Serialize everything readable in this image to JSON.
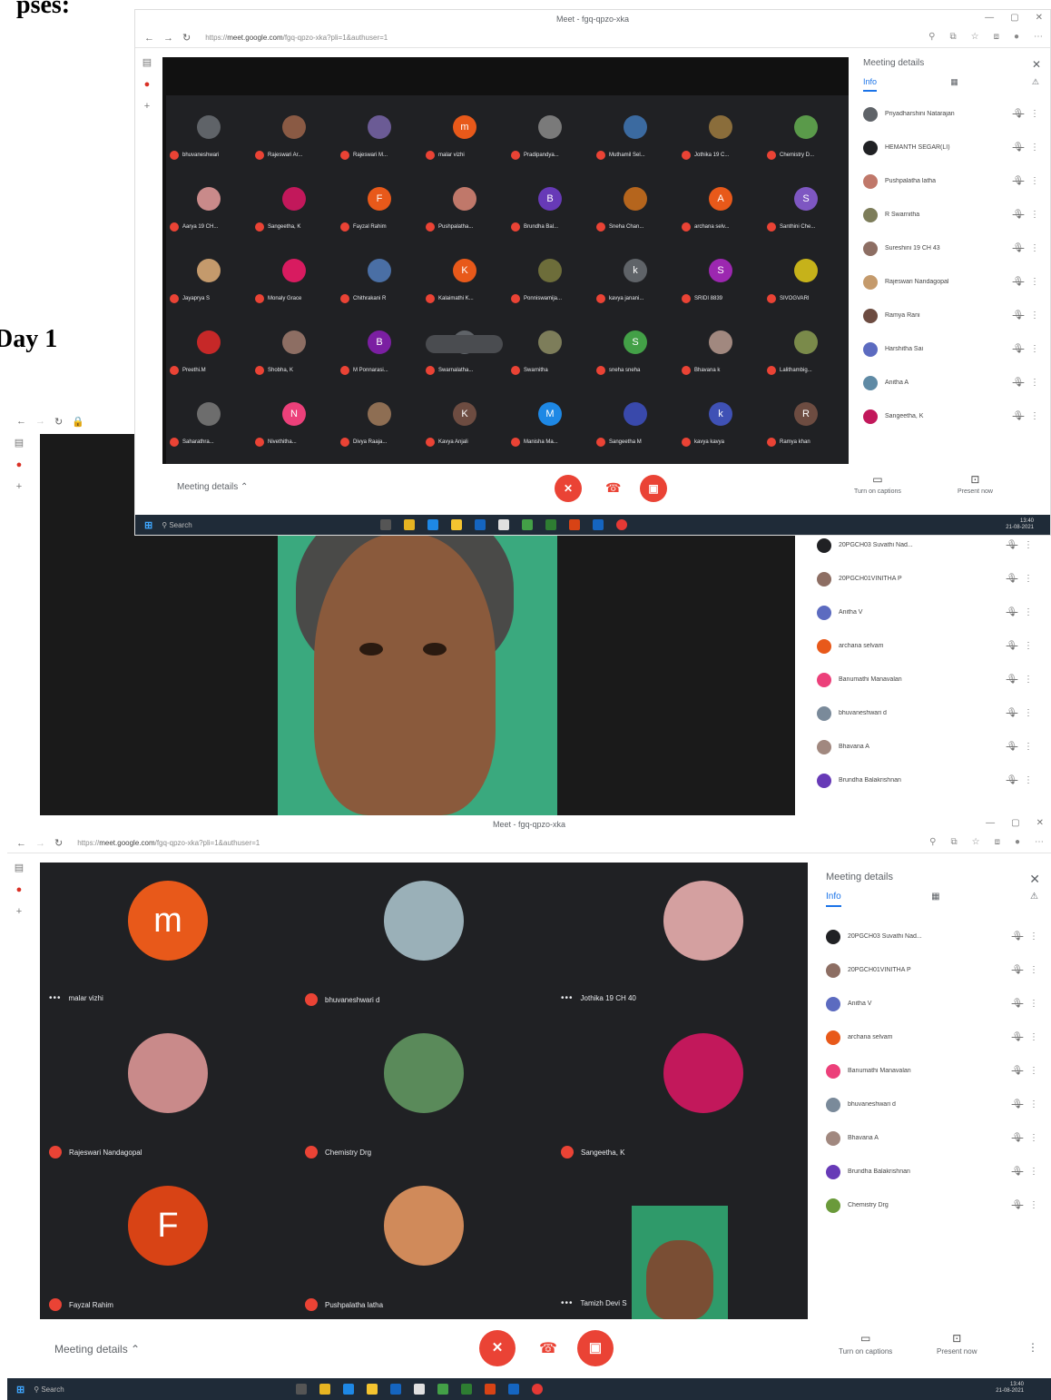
{
  "document": {
    "heading_fragment": "pses:",
    "day_label": "Day 1"
  },
  "colors": {
    "meet_dark": "#202124",
    "mute_red": "#ea4335",
    "accent_blue": "#1a73e8",
    "taskbar": "#1f2b38"
  },
  "window": {
    "title": "Meet - fgq-qpzo-xka",
    "url_host": "meet.google.com",
    "url_path": "/fgq-qpzo-xka?pli=1&authuser=1",
    "url_prefix": "https://"
  },
  "panel": {
    "title": "Meeting details",
    "close_icon": "✕",
    "tab_people": "Info",
    "tab_chat_icon": "▦",
    "tab_activities_icon": "⚠"
  },
  "controls": {
    "meeting_details": "Meeting details",
    "captions": "Turn on captions",
    "present": "Present now"
  },
  "taskbar": {
    "search": "Search",
    "time": "13:40",
    "date": "21-08-2021"
  },
  "screenshot1": {
    "tiles": [
      {
        "label": "bhuvaneshwari",
        "initial": "",
        "color": "#5f6368"
      },
      {
        "label": "Rajeswari Ar...",
        "initial": "",
        "color": "#8a5a44"
      },
      {
        "label": "Rajeswari M...",
        "initial": "",
        "color": "#6b5b95"
      },
      {
        "label": "malar vizhi",
        "initial": "m",
        "color": "#e8591a"
      },
      {
        "label": "Pradipandya...",
        "initial": "",
        "color": "#7a7a7a"
      },
      {
        "label": "Muthamil Sel...",
        "initial": "",
        "color": "#3b6aa0"
      },
      {
        "label": "Jothika 19 C...",
        "initial": "",
        "color": "#8a6d3b"
      },
      {
        "label": "Chemistry D...",
        "initial": "",
        "color": "#5a9a4a"
      },
      {
        "label": "Aarya 19 CH...",
        "initial": "",
        "color": "#c98a8a"
      },
      {
        "label": "Sangeetha, K",
        "initial": "",
        "color": "#c2185b"
      },
      {
        "label": "Fayzal Rahim",
        "initial": "F",
        "color": "#e8591a"
      },
      {
        "label": "Pushpalatha...",
        "initial": "",
        "color": "#c0786a"
      },
      {
        "label": "Brundha Bal...",
        "initial": "B",
        "color": "#673ab7"
      },
      {
        "label": "Sneha Chan...",
        "initial": "",
        "color": "#b5651d"
      },
      {
        "label": "archana selv...",
        "initial": "A",
        "color": "#e8591a"
      },
      {
        "label": "Santhini Che...",
        "initial": "S",
        "color": "#7e57c2"
      },
      {
        "label": "Jayaprya S",
        "initial": "",
        "color": "#c49a6c"
      },
      {
        "label": "Monaly Grace",
        "initial": "",
        "color": "#d81b60"
      },
      {
        "label": "Chithrakani R",
        "initial": "",
        "color": "#4a6fa5"
      },
      {
        "label": "Kalaimathi K...",
        "initial": "K",
        "color": "#e8591a"
      },
      {
        "label": "Ponniswamija...",
        "initial": "",
        "color": "#6d6d3a"
      },
      {
        "label": "kavya janani...",
        "initial": "k",
        "color": "#5f6368"
      },
      {
        "label": "SRIDI 8839",
        "initial": "S",
        "color": "#9c27b0"
      },
      {
        "label": "SIVOGVARI",
        "initial": "",
        "color": "#c6b21a"
      },
      {
        "label": "Preethi.M",
        "initial": "",
        "color": "#c62828"
      },
      {
        "label": "Shobha, K",
        "initial": "",
        "color": "#8d6e63"
      },
      {
        "label": "M Ponnarasi...",
        "initial": "B",
        "color": "#7b1fa2"
      },
      {
        "label": "Swarnalatha...",
        "initial": "",
        "color": "#5f6368"
      },
      {
        "label": "Swarnitha",
        "initial": "",
        "color": "#7d7d5a"
      },
      {
        "label": "sneha sneha",
        "initial": "S",
        "color": "#43a047"
      },
      {
        "label": "Bhavana k",
        "initial": "",
        "color": "#a1887f"
      },
      {
        "label": "Lalithambig...",
        "initial": "",
        "color": "#7a8a4a"
      },
      {
        "label": "Saharathra...",
        "initial": "",
        "color": "#6d6d6d"
      },
      {
        "label": "Nivethitha...",
        "initial": "N",
        "color": "#ec407a"
      },
      {
        "label": "Divya Raaja...",
        "initial": "",
        "color": "#8e6e53"
      },
      {
        "label": "Kavya Anjali",
        "initial": "K",
        "color": "#6d4c41"
      },
      {
        "label": "Manisha Ma...",
        "initial": "M",
        "color": "#1e88e5"
      },
      {
        "label": "Sangeetha M",
        "initial": "",
        "color": "#3949ab"
      },
      {
        "label": "kavya kavya",
        "initial": "k",
        "color": "#3f51b5"
      },
      {
        "label": "Ramya khan",
        "initial": "R",
        "color": "#6d4c41"
      }
    ],
    "participants": [
      {
        "name": "Priyadharshini Natarajan",
        "color": "#5f6368"
      },
      {
        "name": "HEMANTH SEGAR(LI)",
        "color": "#202124"
      },
      {
        "name": "Pushpalatha latha",
        "color": "#c0786a"
      },
      {
        "name": "R Swarnitha",
        "color": "#7d7d5a"
      },
      {
        "name": "Sureshini 19 CH 43",
        "color": "#8d6e63"
      },
      {
        "name": "Rajeswari Nandagopal",
        "color": "#c49a6c"
      },
      {
        "name": "Ramya Rani",
        "color": "#6d4c41"
      },
      {
        "name": "Harshitha Sai",
        "color": "#5c6bc0"
      },
      {
        "name": "Anitha A",
        "color": "#5f8aa5"
      },
      {
        "name": "Sangeetha, K",
        "color": "#c2185b"
      }
    ],
    "mic_icon": "🎙",
    "more_icon": "⋮"
  },
  "screenshot2": {
    "participants": [
      {
        "name": "20PGCH03 Suvathi Nad...",
        "color": "#202124"
      },
      {
        "name": "20PGCH01VINITHA P",
        "color": "#8d6e63"
      },
      {
        "name": "Anitha V",
        "color": "#5c6bc0"
      },
      {
        "name": "archana selvam",
        "color": "#e8591a"
      },
      {
        "name": "Banumathi Manavalan",
        "color": "#ec407a"
      },
      {
        "name": "bhuvaneshwari d",
        "color": "#7a8a9a"
      },
      {
        "name": "Bhavana A",
        "color": "#a1887f"
      },
      {
        "name": "Brundha Balakrishnan",
        "color": "#673ab7"
      }
    ]
  },
  "screenshot3": {
    "tiles": [
      {
        "label": "malar vizhi",
        "initial": "m",
        "color": "#e8591a",
        "muted": false
      },
      {
        "label": "bhuvaneshwari d",
        "initial": "",
        "color": "#9ab0b8",
        "muted": true
      },
      {
        "label": "Jothika 19 CH 40",
        "initial": "",
        "color": "#d4a0a0",
        "muted": false
      },
      {
        "label": "Rajeswari Nandagopal",
        "initial": "",
        "color": "#c98a8a",
        "muted": true
      },
      {
        "label": "Chemistry Drg",
        "initial": "",
        "color": "#5a8a5a",
        "muted": true
      },
      {
        "label": "Sangeetha, K",
        "initial": "",
        "color": "#c2185b",
        "muted": true
      },
      {
        "label": "Fayzal Rahim",
        "initial": "F",
        "color": "#d84315",
        "muted": true
      },
      {
        "label": "Pushpalatha latha",
        "initial": "",
        "color": "#d08a5a",
        "muted": true
      },
      {
        "label": "Tamizh Devi S",
        "initial": "",
        "color": "#2f9a6a",
        "muted": false
      }
    ],
    "participants": [
      {
        "name": "20PGCH03 Suvathi Nad...",
        "color": "#202124"
      },
      {
        "name": "20PGCH01VINITHA P",
        "color": "#8d6e63"
      },
      {
        "name": "Anitha V",
        "color": "#5c6bc0"
      },
      {
        "name": "archana selvam",
        "color": "#e8591a"
      },
      {
        "name": "Banumathi Manavalan",
        "color": "#ec407a"
      },
      {
        "name": "bhuvaneshwari d",
        "color": "#7a8a9a"
      },
      {
        "name": "Bhavana A",
        "color": "#a1887f"
      },
      {
        "name": "Brundha Balakrishnan",
        "color": "#673ab7"
      },
      {
        "name": "Chemistry Drg",
        "color": "#6a9a3a"
      }
    ]
  }
}
